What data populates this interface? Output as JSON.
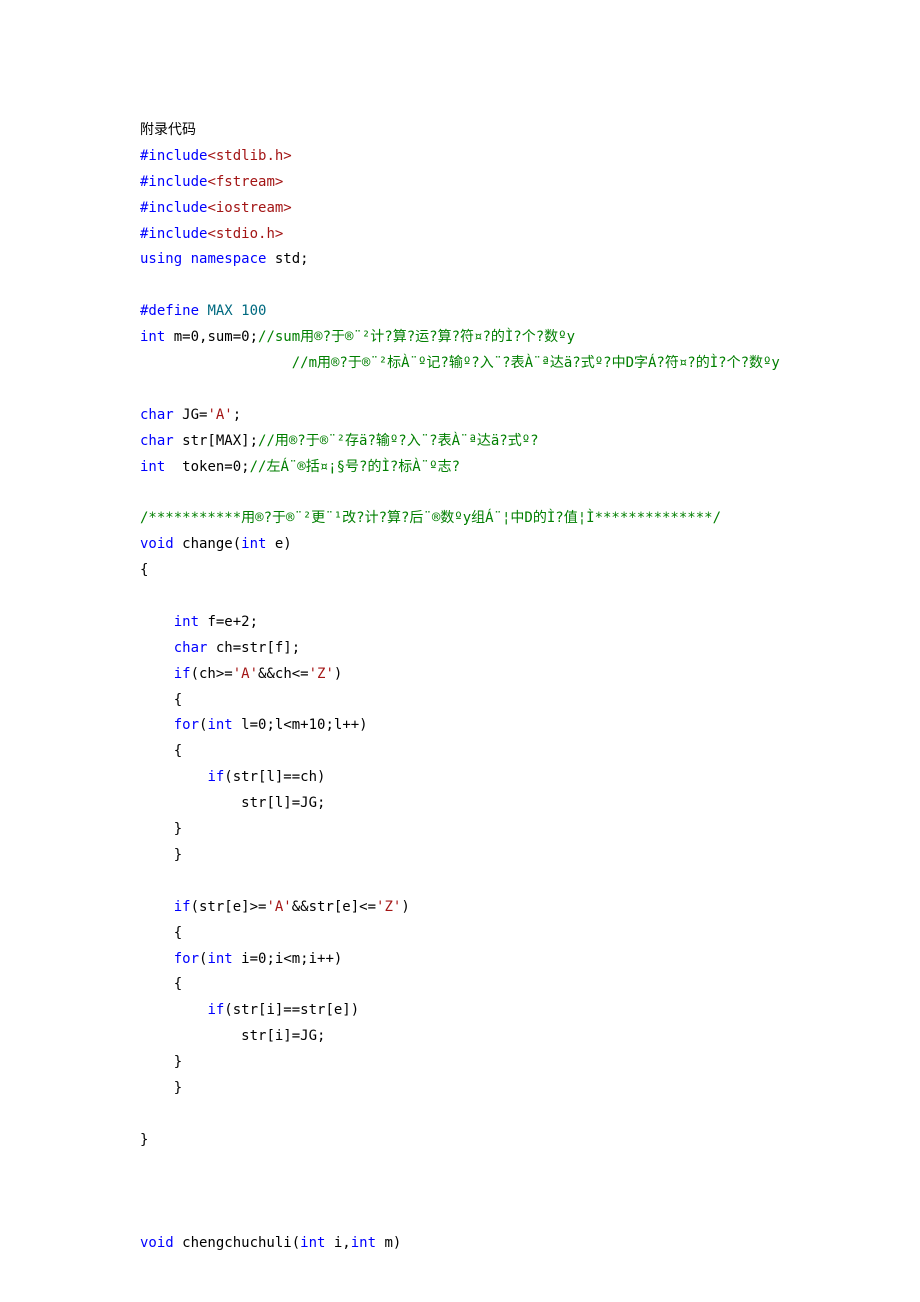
{
  "title": "附录代码",
  "code": {
    "inc1_a": "#include",
    "inc1_b": "<stdlib.h>",
    "inc2_a": "#include",
    "inc2_b": "<fstream>",
    "inc3_a": "#include",
    "inc3_b": "<iostream>",
    "inc4_a": "#include",
    "inc4_b": "<stdio.h>",
    "using_a": "using",
    "using_b": " namespace",
    "using_c": " std;",
    "def_a": "#define",
    "def_b": " MAX 100",
    "l1_a": "int",
    "l1_b": " m=0,sum=0;",
    "l1_c": "//sum用®?于®¨²计?算?运?算?符¤?的Ì?个?数ºy",
    "l2_c": "//m用®?于®¨²标À¨º记?输º?入¨?表À¨ª达ä?式º?中D字Á?符¤?的Ì?个?数ºy",
    "l3_a": "char",
    "l3_b": " JG=",
    "l3_c": "'A'",
    "l3_d": ";",
    "l4_a": "char",
    "l4_b": " str[MAX];",
    "l4_c": "//用®?于®¨²存ä?输º?入¨?表À¨ª达ä?式º?",
    "l5_a": "int",
    "l5_b": "  token=0;",
    "l5_c": "//左Á¨®括¤¡§号?的Ì?标À¨º志?",
    "l6": "/***********用®?于®¨²更¨¹改?计?算?后¨®数ºy组Á¨¦中D的Ì?值¦Ì**************/",
    "l7_a": "void",
    "l7_b": " change(",
    "l7_c": "int",
    "l7_d": " e)",
    "l8": "{",
    "l9_a": "int",
    "l9_b": " f=e+2;",
    "l10_a": "char",
    "l10_b": " ch=str[f];",
    "l11_a": "if",
    "l11_b": "(ch>=",
    "l11_c": "'A'",
    "l11_d": "&&ch<=",
    "l11_e": "'Z'",
    "l11_f": ")",
    "l12": "{",
    "l13_a": "for",
    "l13_b": "(",
    "l13_c": "int",
    "l13_d": " l=0;l<m+10;l++)",
    "l14": "{",
    "l15_a": "if",
    "l15_b": "(str[l]==ch)",
    "l16": "str[l]=JG;",
    "l17": "}",
    "l18": "}",
    "l20_a": "if",
    "l20_b": "(str[e]>=",
    "l20_c": "'A'",
    "l20_d": "&&str[e]<=",
    "l20_e": "'Z'",
    "l20_f": ")",
    "l21": "{",
    "l22_a": "for",
    "l22_b": "(",
    "l22_c": "int",
    "l22_d": " i=0;i<m;i++)",
    "l23": "{",
    "l24_a": "if",
    "l24_b": "(str[i]==str[e])",
    "l25": "str[i]=JG;",
    "l26": "}",
    "l27": "}",
    "l28": "}",
    "lf_a": "void",
    "lf_b": " chengchuchuli(",
    "lf_c": "int",
    "lf_d": " i,",
    "lf_e": "int",
    "lf_f": " m)"
  },
  "indent": {
    "i1": "    ",
    "i2": "        ",
    "i3": "            ",
    "comment2": "                  "
  }
}
